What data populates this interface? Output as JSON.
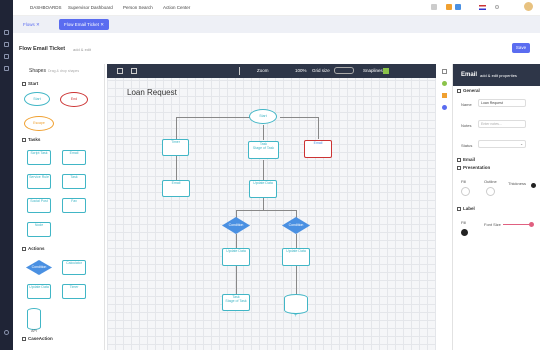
{
  "topbar": {
    "nav": [
      "DASHBOARDS",
      "Supervisor Dashboard",
      "Person Search",
      "Action Center"
    ]
  },
  "tabs": [
    {
      "label": "Flows"
    },
    {
      "label": "Flow Email Ticket"
    }
  ],
  "header": {
    "title": "Flow Email Ticket",
    "subtitle": "add & edit",
    "save_label": "Save"
  },
  "shapes_panel": {
    "title": "Shapes",
    "search_placeholder": "Drag & drop shapes",
    "sections": {
      "start": "Start",
      "tasks": "Tasks",
      "actions": "Actions",
      "case_action": "CaseAction"
    },
    "start_shapes": [
      "Start",
      "End",
      "Escape"
    ],
    "task_shapes": [
      "Script Task",
      "Email",
      "Service Rule",
      "Task",
      "Social Post",
      "Fax",
      "Stage Of Task",
      "Node"
    ],
    "action_shapes": [
      "Condition",
      "Calculator",
      "Update Data",
      "Timer",
      "API"
    ]
  },
  "canvas": {
    "toolbar": {
      "zoom_label": "Zoom",
      "zoom_value": "100%",
      "grid_label": "Grid size",
      "snap_label": "Snaplines"
    },
    "title": "Loan Request",
    "nodes": {
      "start": "Start",
      "timer": "Timer",
      "task": "Task",
      "stage": "Stage of Task",
      "email": "Email",
      "email2": "Email",
      "update1": "Update Data",
      "cond1": "Condition",
      "cond2": "Condition",
      "update2": "Update Data",
      "update3": "Update Data",
      "task2": "Task",
      "stage2": "Stage of Task"
    }
  },
  "properties": {
    "title": "Email",
    "subtitle": "add & edit properties",
    "general": "General",
    "name_label": "Name",
    "name_value": "Loan Request",
    "notes_label": "Notes",
    "notes_placeholder": "Enter notes...",
    "status_label": "Status",
    "email_section": "Email",
    "presentation": "Presentation",
    "fill_label": "Fill",
    "outline_label": "Outline",
    "thickness_label": "Thickness",
    "label_section": "Label",
    "label_fill": "Fill",
    "font_size_label": "Font Size"
  },
  "colors": {
    "accent": "#5a6cf0",
    "teal": "#41b6c6",
    "dark": "#2e3648",
    "red": "#d9534f"
  }
}
